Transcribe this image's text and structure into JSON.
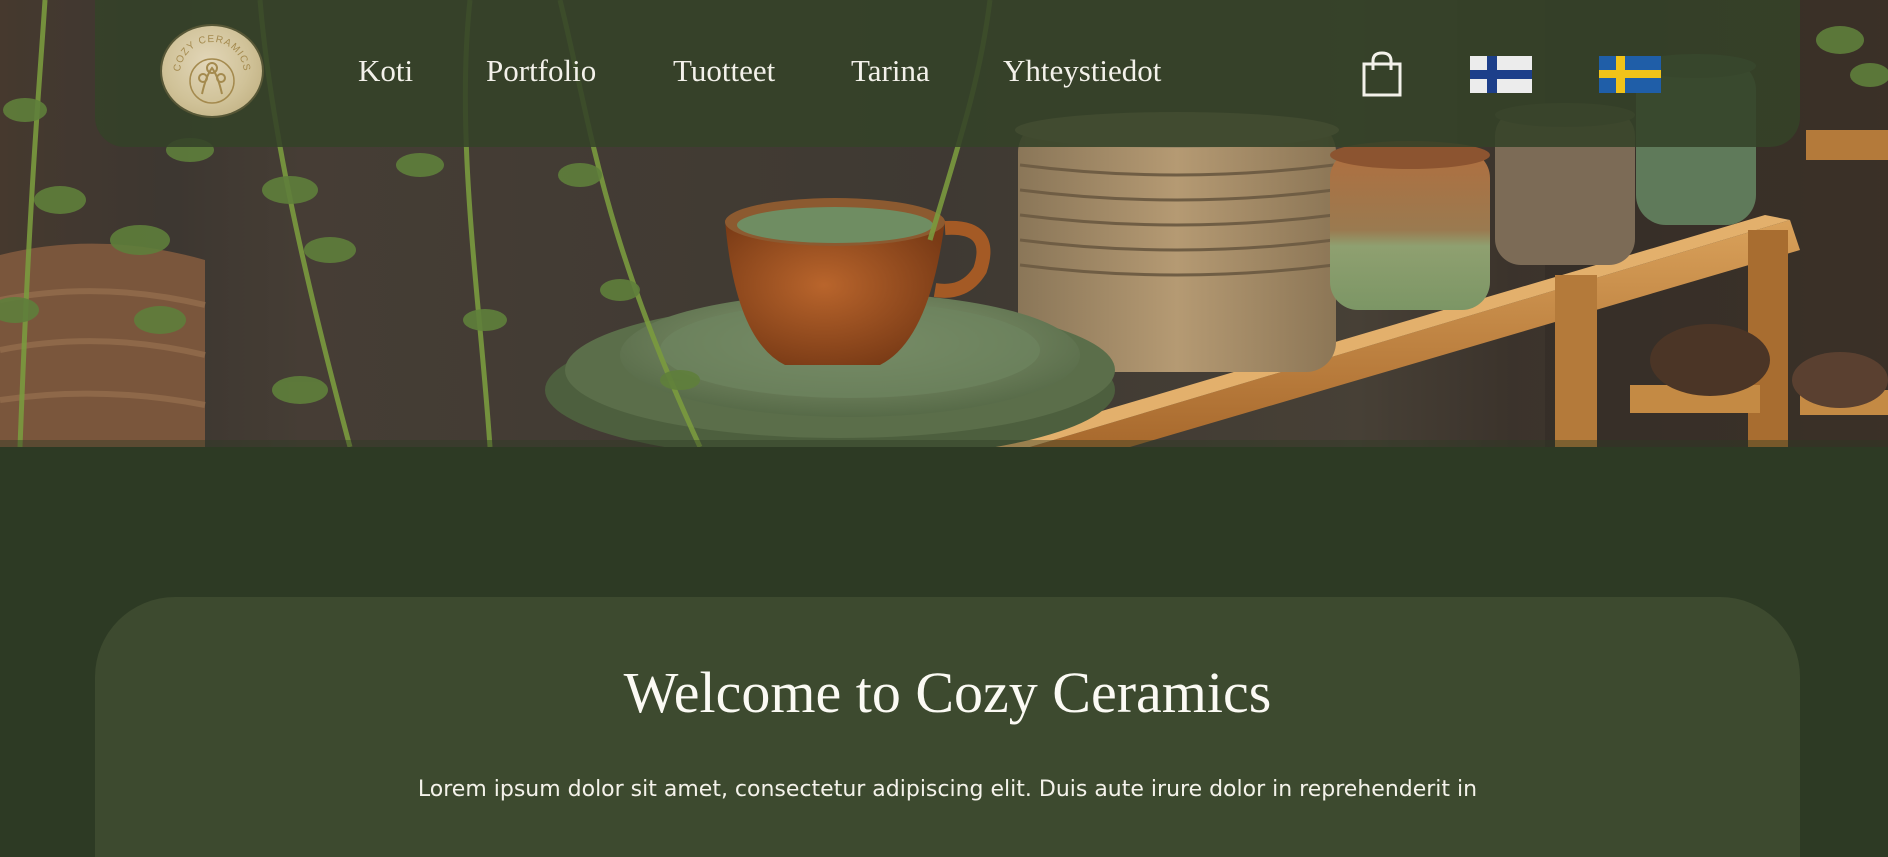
{
  "brand": {
    "logo_text": "COZY CERAMICS"
  },
  "nav": {
    "items": [
      {
        "label": "Koti"
      },
      {
        "label": "Portfolio"
      },
      {
        "label": "Tuotteet"
      },
      {
        "label": "Tarina"
      },
      {
        "label": "Yhteystiedot"
      }
    ]
  },
  "header_icons": {
    "cart_icon": "shopping-bag-icon",
    "languages": [
      {
        "name": "finnish-flag-icon",
        "colors": [
          "#ffffff",
          "#1d3f8a"
        ]
      },
      {
        "name": "swedish-flag-icon",
        "colors": [
          "#1f5ea8",
          "#f1c319"
        ]
      }
    ]
  },
  "main": {
    "title": "Welcome to Cozy Ceramics",
    "intro": "Lorem ipsum dolor sit amet, consectetur adipiscing elit. Duis aute irure dolor in reprehenderit in"
  },
  "colors": {
    "page_background": "#2d3a24",
    "header_background": "#344228",
    "card_background": "#3d4a2f",
    "text": "#f3f1ea"
  }
}
